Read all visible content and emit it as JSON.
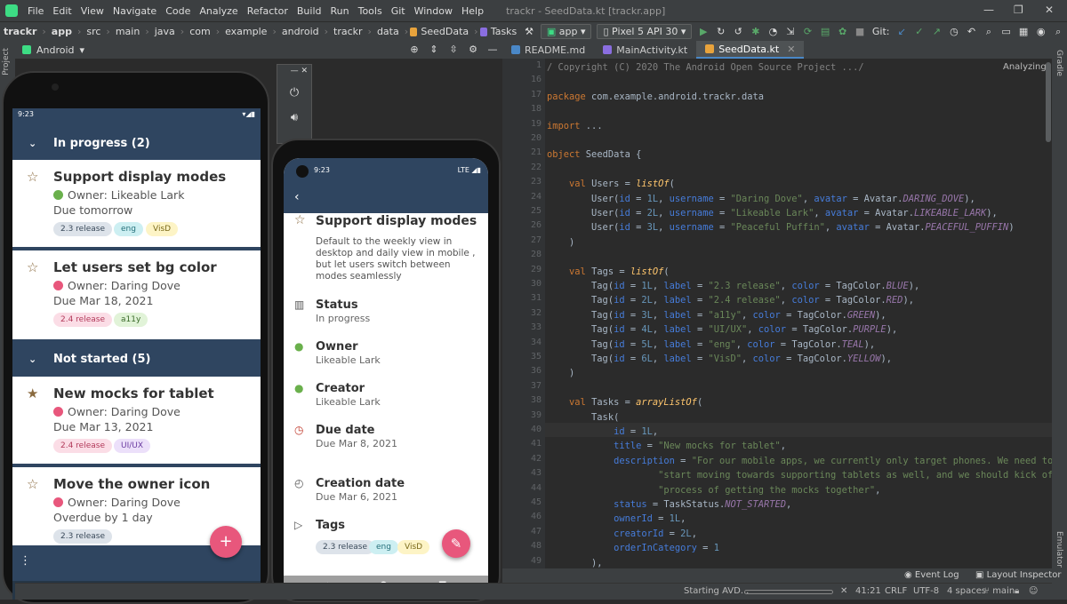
{
  "menubar": {
    "items": [
      "File",
      "Edit",
      "View",
      "Navigate",
      "Code",
      "Analyze",
      "Refactor",
      "Build",
      "Run",
      "Tools",
      "Git",
      "Window",
      "Help"
    ],
    "title": "trackr - SeedData.kt [trackr.app]",
    "min": "—",
    "max": "❐",
    "close": "✕"
  },
  "toolbar": {
    "breadcrumbs": [
      "trackr",
      "app",
      "src",
      "main",
      "java",
      "com",
      "example",
      "android",
      "trackr",
      "data",
      "SeedData",
      "Tasks"
    ],
    "run_config": "app",
    "device": "Pixel 5 API 30",
    "git_label": "Git:"
  },
  "left_panel": {
    "strip_label": "Project",
    "view_selector": "Android"
  },
  "right_strip": {
    "top": "Gradle",
    "bottom": "Emulator"
  },
  "editor": {
    "tabs": [
      {
        "label": "README.md",
        "color": "#4a88c7",
        "active": false
      },
      {
        "label": "MainActivity.kt",
        "color": "#8a6ee0",
        "active": false
      },
      {
        "label": "SeedData.kt",
        "color": "#e8a33c",
        "active": true
      }
    ],
    "status_hint": "Analyzing...",
    "line_numbers": [
      "1",
      "16",
      "17",
      "18",
      "19",
      "20",
      "21",
      "22",
      "23",
      "24",
      "25",
      "26",
      "27",
      "28",
      "29",
      "30",
      "31",
      "32",
      "33",
      "34",
      "35",
      "36",
      "37",
      "38",
      "39",
      "40",
      "41",
      "42",
      "43",
      "44",
      "45",
      "46",
      "47",
      "48",
      "49",
      "50"
    ],
    "lines": [
      "/ Copyright (C) 2020 The Android Open Source Project .../",
      "",
      "package com.example.android.trackr.data",
      "",
      "import ...",
      "",
      "object SeedData {",
      "",
      "    val Users = listOf(",
      "        User(id = 1L, username = \"Daring Dove\", avatar = Avatar.DARING_DOVE),",
      "        User(id = 2L, username = \"Likeable Lark\", avatar = Avatar.LIKEABLE_LARK),",
      "        User(id = 3L, username = \"Peaceful Puffin\", avatar = Avatar.PEACEFUL_PUFFIN)",
      "    )",
      "",
      "    val Tags = listOf(",
      "        Tag(id = 1L, label = \"2.3 release\", color = TagColor.BLUE),",
      "        Tag(id = 2L, label = \"2.4 release\", color = TagColor.RED),",
      "        Tag(id = 3L, label = \"a11y\", color = TagColor.GREEN),",
      "        Tag(id = 4L, label = \"UI/UX\", color = TagColor.PURPLE),",
      "        Tag(id = 5L, label = \"eng\", color = TagColor.TEAL),",
      "        Tag(id = 6L, label = \"VisD\", color = TagColor.YELLOW),",
      "    )",
      "",
      "    val Tasks = arrayListOf(",
      "        Task(",
      "            id = 1L,",
      "            title = \"New mocks for tablet\",",
      "            description = \"For our mobile apps, we currently only target phones. We need to",
      "                    \"start moving towards supporting tablets as well, and we should kick of",
      "                    \"process of getting the mocks together\",",
      "            status = TaskStatus.NOT_STARTED,",
      "            ownerId = 1L,",
      "            creatorId = 2L,",
      "            orderInCategory = 1",
      "        ),",
      ""
    ]
  },
  "bottom_tools": {
    "event_log": "Event Log",
    "layout_inspector": "Layout Inspector"
  },
  "status": {
    "left": "Starting AVD...",
    "position": "41:21",
    "line_sep": "CRLF",
    "encoding": "UTF-8",
    "indent": "4 spaces",
    "branch": "main"
  },
  "phone1": {
    "time": "9:23",
    "sections": [
      {
        "label": "In progress (2)"
      },
      {
        "label": "Not started (5)"
      }
    ],
    "cards": [
      {
        "title": "Support display modes",
        "owner": "Owner: Likeable Lark",
        "due": "Due tomorrow",
        "starred": false,
        "avatar_color": "#6ab04c",
        "tags": [
          {
            "label": "2.3 release",
            "bg": "#dde3ea",
            "fg": "#3a4a5a"
          },
          {
            "label": "eng",
            "bg": "#cdeff2",
            "fg": "#25707a"
          },
          {
            "label": "VisD",
            "bg": "#fdf4c6",
            "fg": "#7a6a1a"
          }
        ]
      },
      {
        "title": "Let users set bg color",
        "owner": "Owner: Daring Dove",
        "due": "Due Mar 18, 2021",
        "starred": false,
        "avatar_color": "#e8577c",
        "tags": [
          {
            "label": "2.4 release",
            "bg": "#fbdde6",
            "fg": "#b23a5a"
          },
          {
            "label": "a11y",
            "bg": "#e1f3d8",
            "fg": "#3a6a2a"
          }
        ]
      },
      {
        "title": "New mocks for tablet",
        "owner": "Owner: Daring Dove",
        "due": "Due Mar 13, 2021",
        "starred": true,
        "avatar_color": "#e8577c",
        "tags": [
          {
            "label": "2.4 release",
            "bg": "#fbdde6",
            "fg": "#b23a5a"
          },
          {
            "label": "UI/UX",
            "bg": "#ece0fa",
            "fg": "#6a3aa0"
          }
        ]
      },
      {
        "title": "Move the owner icon",
        "owner": "Owner: Daring Dove",
        "due": "Overdue by 1 day",
        "starred": false,
        "avatar_color": "#e8577c",
        "tags": [
          {
            "label": "2.3 release",
            "bg": "#dde3ea",
            "fg": "#3a4a5a"
          }
        ]
      }
    ],
    "fab": "+",
    "menu": "⋮"
  },
  "phone2": {
    "time": "9:23",
    "network": "LTE",
    "title": "Support display modes",
    "description": "Default to the weekly view in desktop and daily view in mobile , but let users switch between modes seamlessly",
    "fields": [
      {
        "label": "Status",
        "value": "In progress"
      },
      {
        "label": "Owner",
        "value": "Likeable Lark"
      },
      {
        "label": "Creator",
        "value": "Likeable Lark"
      },
      {
        "label": "Due date",
        "value": "Due Mar 8, 2021"
      },
      {
        "label": "Creation date",
        "value": "Due Mar 6, 2021"
      },
      {
        "label": "Tags",
        "value": ""
      }
    ],
    "tags": [
      {
        "label": "2.3 release",
        "bg": "#dde3ea",
        "fg": "#3a4a5a"
      },
      {
        "label": "eng",
        "bg": "#cdeff2",
        "fg": "#25707a"
      },
      {
        "label": "VisD",
        "bg": "#fdf4c6",
        "fg": "#7a6a1a"
      }
    ],
    "fab": "✎"
  },
  "colors": {
    "accent": "#e8577c",
    "appbar": "#2f4560",
    "ide_bg": "#2b2b2b"
  }
}
